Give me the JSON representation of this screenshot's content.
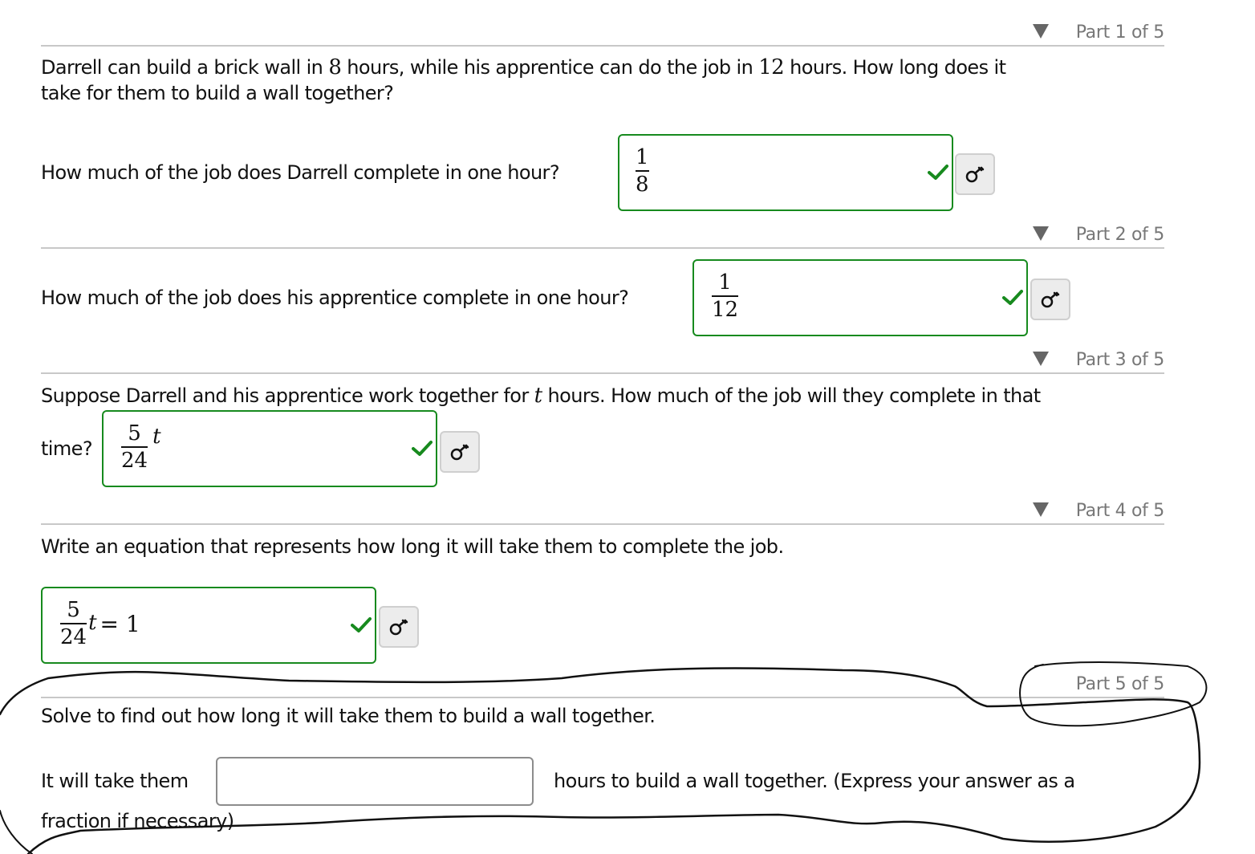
{
  "parts": [
    {
      "label": "Part 1 of 5"
    },
    {
      "label": "Part 2 of 5"
    },
    {
      "label": "Part 3 of 5"
    },
    {
      "label": "Part 4 of 5"
    },
    {
      "label": "Part 5 of 5"
    }
  ],
  "problem": {
    "seg1": "Darrell can build a brick wall in ",
    "num1": "8",
    "seg2": " hours, while his apprentice can do the job in ",
    "num2": "12",
    "seg3": " hours. How long does it",
    "line2": "take for them to build a wall together?"
  },
  "q1": {
    "prompt": "How much of the job does Darrell complete in one hour?",
    "answer": {
      "numerator": "1",
      "denominator": "8"
    },
    "status": "correct"
  },
  "q2": {
    "prompt": "How much of the job does his apprentice complete in one hour?",
    "answer": {
      "numerator": "1",
      "denominator": "12"
    },
    "status": "correct"
  },
  "q3": {
    "prompt_a": "Suppose Darrell and his apprentice work together for ",
    "var": "t",
    "prompt_b": " hours. How much of the job will they complete in that",
    "prompt_c": "time?",
    "answer": {
      "numerator": "5",
      "denominator": "24",
      "suffix": "t"
    },
    "status": "correct"
  },
  "q4": {
    "prompt": "Write an equation that represents how long it will take them to complete the job.",
    "answer": {
      "numerator": "5",
      "denominator": "24",
      "var": "t",
      "rest": "= 1"
    },
    "status": "correct"
  },
  "q5": {
    "prompt": "Solve to find out how long it will take them to build a wall together.",
    "before": "It will take them",
    "after": "hours to build a wall together. (Express your answer as a",
    "after2": "fraction if necessary)",
    "value": "",
    "placeholder": ""
  },
  "colors": {
    "correct": "#178a1e",
    "header_text": "#777777",
    "rule": "#c8c8c8"
  }
}
